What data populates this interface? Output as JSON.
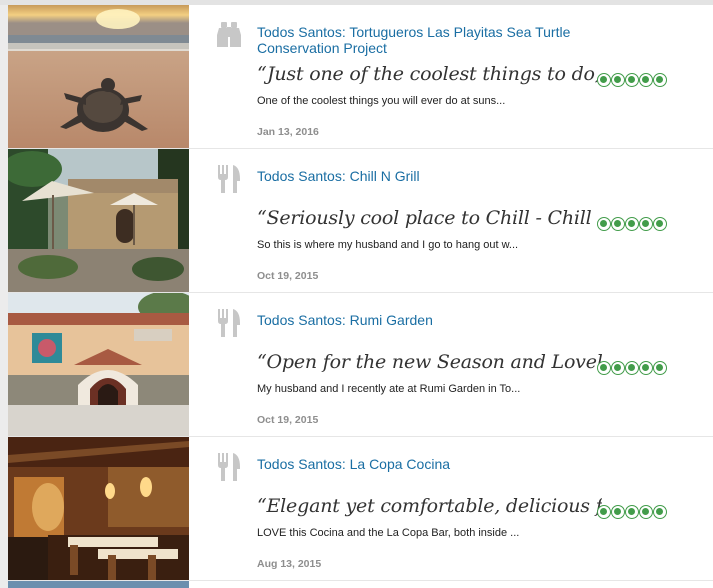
{
  "reviews": [
    {
      "category_icon": "binoculars-icon",
      "title": "Todos Santos: Tortugueros Las Playitas Sea Turtle Conservation Project",
      "quote": "“Just one of the coolest things to do, ...",
      "snippet": "One of the coolest things you will ever do at suns...",
      "date": "Jan 13, 2016",
      "rating": 5
    },
    {
      "category_icon": "fork-knife-icon",
      "title": "Todos Santos: Chill N Grill",
      "quote": "“Seriously cool place to Chill - Chill ...",
      "snippet": "So this is where my husband and I go to hang out w...",
      "date": "Oct 19, 2015",
      "rating": 5
    },
    {
      "category_icon": "fork-knife-icon",
      "title": "Todos Santos: Rumi Garden",
      "quote": "“Open for the new Season and Lovel...",
      "snippet": "My husband and I recently ate at Rumi Garden in To...",
      "date": "Oct 19, 2015",
      "rating": 5
    },
    {
      "category_icon": "fork-knife-icon",
      "title": "Todos Santos: La Copa Cocina",
      "quote": "“Elegant yet comfortable, delicious f...",
      "snippet": "LOVE this Cocina and the La Copa Bar, both inside ...",
      "date": "Aug 13, 2015",
      "rating": 5
    }
  ],
  "colors": {
    "link": "#1a6ea3",
    "rating_green": "#429c4a",
    "date_gray": "#8e8e8e"
  }
}
